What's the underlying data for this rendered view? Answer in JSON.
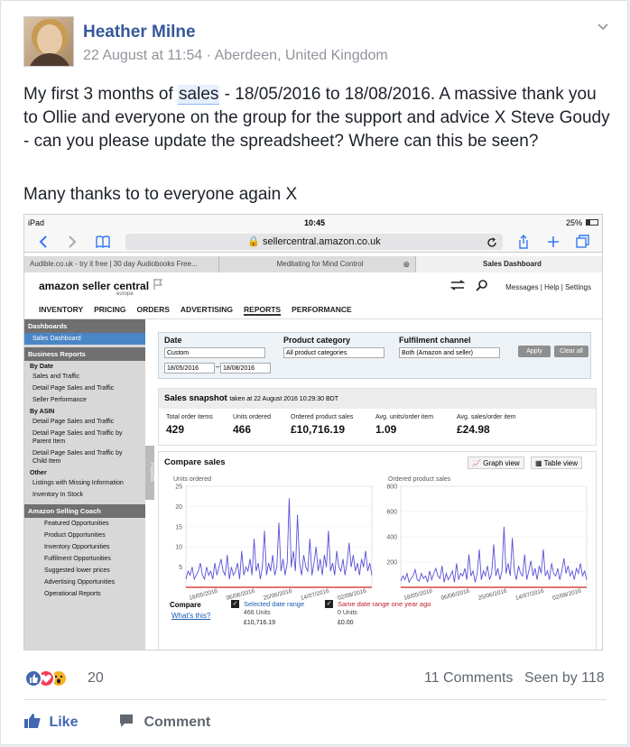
{
  "post": {
    "author": "Heather Milne",
    "meta": "22 August at 11:54 · Aberdeen, United Kingdom",
    "text_before": "My first 3 months of ",
    "text_highlight": "sales",
    "text_after": " - 18/05/2016 to 18/08/2016. A massive thank you to Ollie and everyone on the group for the support and advice X Steve Goudy - can you please update the spreadsheet? Where can this be seen?",
    "text2": "Many thanks to to everyone again X"
  },
  "screenshot": {
    "status": {
      "device": "iPad",
      "time": "10:45",
      "battery": "25%"
    },
    "url": "sellercentral.amazon.co.uk",
    "tabs": [
      "Audible.co.uk - try it free | 30 day Audiobooks Free...",
      "Meditating for Mind Control",
      "Sales Dashboard"
    ],
    "amazon": {
      "logo": "amazon seller central",
      "region": "europe",
      "links": "Messages | Help | Settings",
      "nav": [
        "INVENTORY",
        "PRICING",
        "ORDERS",
        "ADVERTISING",
        "REPORTS",
        "PERFORMANCE"
      ]
    },
    "sidebar": {
      "dashboards": "Dashboards",
      "sales_dashboard": "Sales Dashboard",
      "business_reports": "Business Reports",
      "by_date": "By Date",
      "date_items": [
        "Sales and Traffic",
        "Detail Page Sales and Traffic",
        "Seller Performance"
      ],
      "by_asin": "By ASIN",
      "asin_items": [
        "Detail Page Sales and Traffic",
        "Detail Page Sales and Traffic by Parent Item",
        "Detail Page Sales and Traffic by Child Item"
      ],
      "other": "Other",
      "other_items": [
        "Listings with Missing Information",
        "Inventory In Stock"
      ],
      "coach": "Amazon Selling Coach",
      "coach_items": [
        "Featured Opportunities",
        "Product Opportunities",
        "Inventory Opportunities",
        "Fulfilment Opportunities",
        "Suggested lower prices",
        "Advertising Opportunities",
        "Operational Reports"
      ],
      "reports_tab": "Reports"
    },
    "filters": {
      "date_label": "Date",
      "date_value": "Custom",
      "from": "18/05/2016",
      "to": "18/08/2016",
      "category_label": "Product category",
      "category_value": "All product categories",
      "channel_label": "Fulfilment channel",
      "channel_value": "Both (Amazon and seller)",
      "apply": "Apply",
      "clear": "Clear all"
    },
    "snapshot": {
      "title": "Sales snapshot",
      "taken": "taken at 22 August 2016 10:29:30 BDT",
      "stats": [
        {
          "label": "Total order items",
          "value": "429"
        },
        {
          "label": "Units ordered",
          "value": "466"
        },
        {
          "label": "Ordered product sales",
          "value": "£10,716.19"
        },
        {
          "label": "Avg. units/order item",
          "value": "1.09"
        },
        {
          "label": "Avg. sales/order item",
          "value": "£24.98"
        }
      ]
    },
    "compare": {
      "title": "Compare sales",
      "graph_view": "Graph view",
      "table_view": "Table view",
      "compare_label": "Compare",
      "whats_this": "What's this?",
      "selected_range": "Selected date range",
      "selected_units": "466 Units",
      "selected_sales": "£10,716.19",
      "last_year": "Same date range one year ago",
      "last_units": "0 Units",
      "last_sales": "£0.00"
    }
  },
  "chart_data": [
    {
      "type": "line",
      "title": "",
      "ylabel": "Units ordered",
      "ylim": [
        0,
        25
      ],
      "yticks": [
        5,
        10,
        15,
        20,
        25
      ],
      "xticks": [
        "18/05/2016",
        "06/06/2016",
        "25/06/2016",
        "14/07/2016",
        "02/08/2016"
      ],
      "series": [
        {
          "values": [
            2,
            4,
            3,
            5,
            2,
            3,
            4,
            6,
            3,
            2,
            5,
            3,
            4,
            2,
            6,
            3,
            5,
            7,
            4,
            3,
            8,
            2,
            5,
            3,
            4,
            6,
            2,
            9,
            3,
            5,
            4,
            7,
            3,
            12,
            4,
            6,
            2,
            5,
            14,
            3,
            6,
            4,
            8,
            3,
            5,
            16,
            4,
            7,
            3,
            6,
            22,
            5,
            9,
            4,
            18,
            6,
            3,
            8,
            5,
            4,
            12,
            3,
            6,
            10,
            4,
            7,
            3,
            8,
            5,
            14,
            4,
            6,
            3,
            9,
            5,
            4,
            7,
            3,
            6,
            11,
            5,
            8,
            4,
            6,
            3,
            7,
            5,
            9,
            4,
            6,
            3
          ]
        },
        {
          "values": [
            0,
            0,
            0,
            0,
            0,
            0,
            0,
            0,
            0,
            0,
            0,
            0,
            0,
            0,
            0,
            0,
            0,
            0,
            0,
            0,
            0,
            0,
            0,
            0,
            0,
            0,
            0,
            0,
            0,
            0,
            0,
            0,
            0,
            0,
            0,
            0,
            0,
            0,
            0,
            0,
            0,
            0,
            0,
            0,
            0,
            0,
            0,
            0,
            0,
            0,
            0,
            0,
            0,
            0,
            0,
            0,
            0,
            0,
            0,
            0,
            0,
            0,
            0,
            0,
            0,
            0,
            0,
            0,
            0,
            0,
            0,
            0,
            0,
            0,
            0,
            0,
            0,
            0,
            0,
            0,
            0,
            0,
            0,
            0,
            0,
            0,
            0,
            0,
            0,
            0,
            0
          ]
        }
      ]
    },
    {
      "type": "line",
      "title": "",
      "ylabel": "Ordered product sales",
      "ylim": [
        0,
        800
      ],
      "yticks": [
        200,
        400,
        600,
        800
      ],
      "xticks": [
        "18/05/2016",
        "06/06/2016",
        "25/06/2016",
        "14/07/2016",
        "02/08/2016"
      ],
      "series": [
        {
          "values": [
            50,
            90,
            60,
            110,
            40,
            70,
            90,
            140,
            60,
            50,
            110,
            70,
            90,
            40,
            130,
            60,
            110,
            150,
            90,
            70,
            170,
            40,
            110,
            60,
            90,
            130,
            40,
            190,
            60,
            110,
            90,
            150,
            60,
            260,
            90,
            130,
            40,
            110,
            300,
            60,
            130,
            90,
            170,
            60,
            110,
            340,
            90,
            150,
            60,
            130,
            480,
            110,
            190,
            90,
            390,
            130,
            60,
            170,
            110,
            90,
            260,
            60,
            130,
            210,
            90,
            150,
            60,
            170,
            110,
            300,
            90,
            130,
            60,
            190,
            110,
            90,
            150,
            60,
            130,
            230,
            110,
            170,
            90,
            130,
            60,
            150,
            110,
            190,
            90,
            130,
            60
          ]
        },
        {
          "values": [
            0,
            0,
            0,
            0,
            0,
            0,
            0,
            0,
            0,
            0,
            0,
            0,
            0,
            0,
            0,
            0,
            0,
            0,
            0,
            0,
            0,
            0,
            0,
            0,
            0,
            0,
            0,
            0,
            0,
            0,
            0,
            0,
            0,
            0,
            0,
            0,
            0,
            0,
            0,
            0,
            0,
            0,
            0,
            0,
            0,
            0,
            0,
            0,
            0,
            0,
            0,
            0,
            0,
            0,
            0,
            0,
            0,
            0,
            0,
            0,
            0,
            0,
            0,
            0,
            0,
            0,
            0,
            0,
            0,
            0,
            0,
            0,
            0,
            0,
            0,
            0,
            0,
            0,
            0,
            0,
            0,
            0,
            0,
            0,
            0,
            0,
            0,
            0,
            0,
            0,
            0
          ]
        }
      ]
    }
  ],
  "footer": {
    "reaction_count": "20",
    "comments": "11 Comments",
    "seen": "Seen by 118",
    "like": "Like",
    "comment": "Comment"
  },
  "colors": {
    "link": "#365899",
    "series": "#5a50d8",
    "baseline": "#cc2222"
  }
}
